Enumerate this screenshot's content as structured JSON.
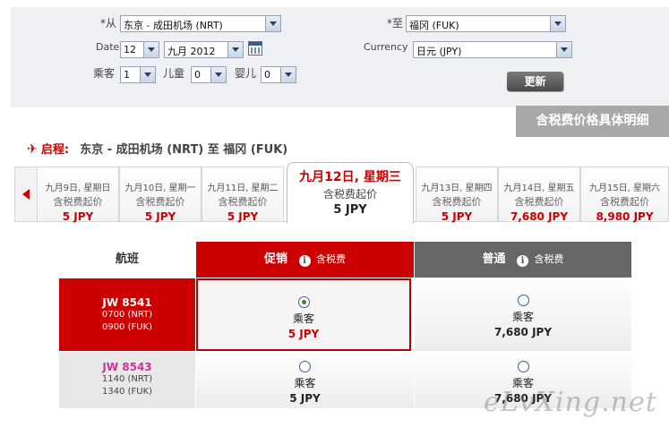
{
  "form": {
    "from_label": "*从",
    "from_value": "东京 - 成田机场 (NRT)",
    "to_label": "*至",
    "to_value": "福冈 (FUK)",
    "date_label": "Date",
    "day_value": "12",
    "month_value": "九月 2012",
    "currency_label": "Currency",
    "currency_value": "日元 (JPY)",
    "adult_label": "乘客",
    "adult_value": "1",
    "child_label": "儿童",
    "child_value": "0",
    "infant_label": "婴儿",
    "infant_value": "0",
    "update_label": "更新"
  },
  "breakdown_label": "含税费价格具体明细",
  "route": {
    "plane": "✈",
    "label": "启程:",
    "text": "东京 - 成田机场 (NRT)  至  福冈 (FUK)"
  },
  "days": [
    {
      "date": "九月9日, 星期日",
      "from": "含税费起价",
      "price": "5 JPY"
    },
    {
      "date": "九月10日, 星期一",
      "from": "含税费起价",
      "price": "5 JPY"
    },
    {
      "date": "九月11日, 星期二",
      "from": "含税费起价",
      "price": "5 JPY"
    },
    {
      "date": "九月12日, 星期三",
      "from": "含税费起价",
      "price": "5 JPY"
    },
    {
      "date": "九月13日, 星期四",
      "from": "含税费起价",
      "price": "5 JPY"
    },
    {
      "date": "九月14日, 星期五",
      "from": "含税费起价",
      "price": "7,680 JPY"
    },
    {
      "date": "九月15日, 星期六",
      "from": "含税费起价",
      "price": "8,980 JPY"
    }
  ],
  "table": {
    "flight_header": "航班",
    "promo_header": "促销",
    "normal_header": "普通",
    "tax_note": "含税费",
    "info_icon": "i",
    "flights": [
      {
        "number": "JW  8541",
        "depart": "0700  (NRT)",
        "arrive": "0900  (FUK)",
        "promo": {
          "pax": "乘客",
          "amount": "5 JPY",
          "selected": true
        },
        "normal": {
          "pax": "乘客",
          "amount": "7,680 JPY",
          "selected": false
        }
      },
      {
        "number": "JW  8543",
        "depart": "1140  (NRT)",
        "arrive": "1340  (FUK)",
        "promo": {
          "pax": "乘客",
          "amount": "5 JPY",
          "selected": false
        },
        "normal": {
          "pax": "乘客",
          "amount": "7,680 JPY",
          "selected": false
        }
      }
    ]
  },
  "watermark": "eLvXing.net",
  "colors": {
    "accent": "#cc0000",
    "normal_header": "#666666",
    "panel": "#eef0f3"
  }
}
